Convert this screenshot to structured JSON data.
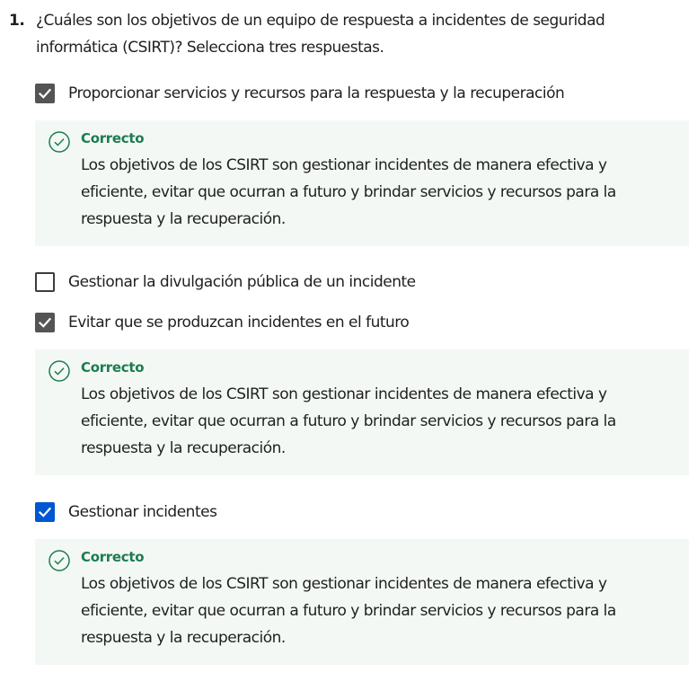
{
  "question": {
    "number": "1.",
    "text": "¿Cuáles son los objetivos de un equipo de respuesta a incidentes de seguridad informática (CSIRT)? Selecciona tres respuestas."
  },
  "options": [
    {
      "label": "Proporcionar servicios y recursos para la respuesta y la recuperación",
      "checked": true,
      "feedback": {
        "title": "Correcto",
        "text": "Los objetivos de los CSIRT son gestionar incidentes de manera efectiva y eficiente, evitar que ocurran a futuro y brindar servicios y recursos para la respuesta y la recuperación."
      }
    },
    {
      "label": "Gestionar la divulgación pública de un incidente",
      "checked": false
    },
    {
      "label": "Evitar que se produzcan incidentes en el futuro",
      "checked": true,
      "feedback": {
        "title": "Correcto",
        "text": "Los objetivos de los CSIRT son gestionar incidentes de manera efectiva y eficiente, evitar que ocurran a futuro y brindar servicios y recursos para la respuesta y la recuperación."
      }
    },
    {
      "label": "Gestionar incidentes",
      "checked": true,
      "focused": true,
      "feedback": {
        "title": "Correcto",
        "text": "Los objetivos de los CSIRT son gestionar incidentes de manera efectiva y eficiente, evitar que ocurran a futuro y brindar servicios y recursos para la respuesta y la recuperación."
      }
    }
  ],
  "icons": {
    "checked": "checkmark-icon",
    "feedback": "check-circle-icon"
  },
  "colors": {
    "checkbox_checked": "#545454",
    "checkbox_active": "#0056d2",
    "feedback_background": "#f3f8f5",
    "correct_green": "#1d7c50"
  }
}
